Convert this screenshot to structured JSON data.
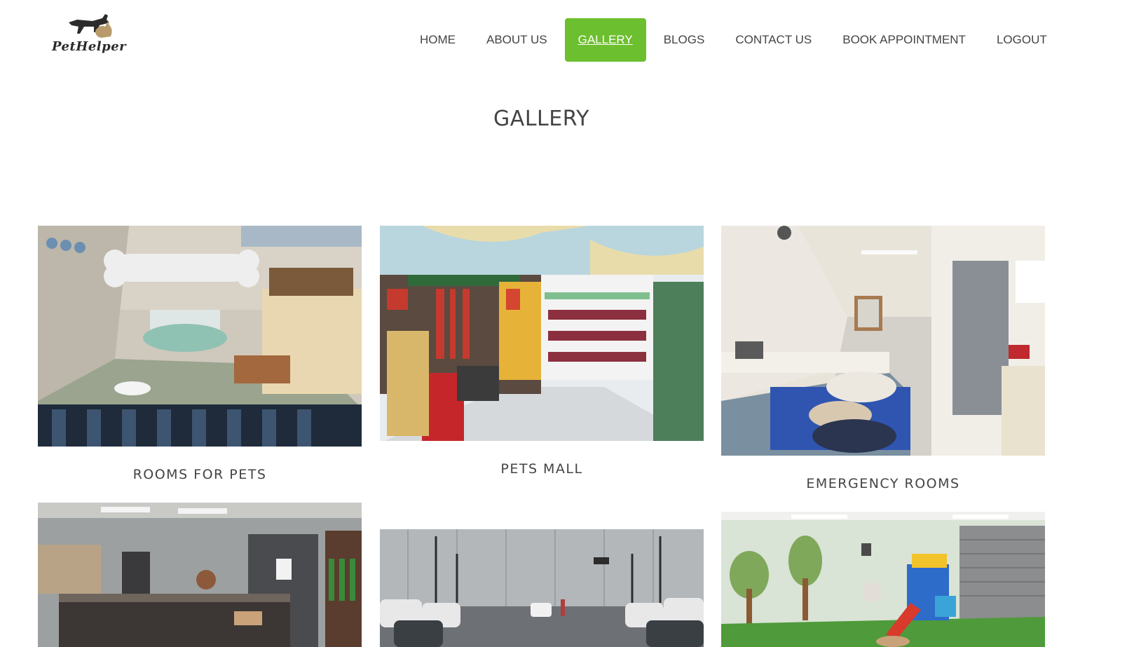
{
  "brand": {
    "logo_text": "PetHelper",
    "logo_icon": "dog-cat-icon"
  },
  "nav": {
    "items": [
      {
        "label": "HOME",
        "active": false
      },
      {
        "label": "ABOUT US",
        "active": false
      },
      {
        "label": "GALLERY",
        "active": true
      },
      {
        "label": "BLOGS",
        "active": false
      },
      {
        "label": "CONTACT US",
        "active": false
      },
      {
        "label": "BOOK APPOINTMENT",
        "active": false
      },
      {
        "label": "LOGOUT",
        "active": false
      }
    ]
  },
  "page": {
    "title": "GALLERY"
  },
  "gallery": {
    "items": [
      {
        "caption": "ROOMS FOR PETS"
      },
      {
        "caption": "PETS MALL"
      },
      {
        "caption": "EMERGENCY ROOMS"
      },
      {
        "caption": ""
      },
      {
        "caption": ""
      },
      {
        "caption": ""
      }
    ]
  },
  "colors": {
    "accent": "#6cbf2e",
    "text": "#444444"
  }
}
